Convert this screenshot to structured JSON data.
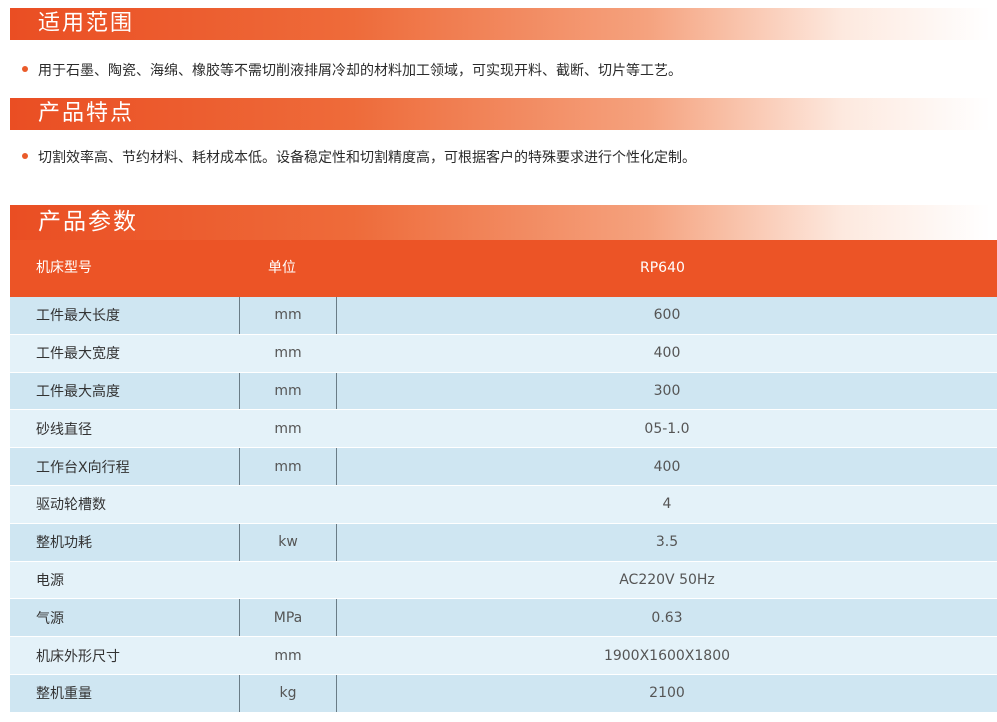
{
  "sections": {
    "scope": {
      "title": "适用范围",
      "text": "用于石墨、陶瓷、海绵、橡胶等不需切削液排屑冷却的材料加工领域，可实现开料、截断、切片等工艺。"
    },
    "features": {
      "title": "产品特点",
      "text": "切割效率高、节约材料、耗材成本低。设备稳定性和切割精度高，可根据客户的特殊要求进行个性化定制。"
    },
    "params": {
      "title": "产品参数"
    }
  },
  "table": {
    "headers": [
      "机床型号",
      "单位",
      "RP640"
    ],
    "rows": [
      {
        "name": "工件最大长度",
        "unit": "mm",
        "value": "600",
        "unit_bordered": true
      },
      {
        "name": "工件最大宽度",
        "unit": "mm",
        "value": "400",
        "unit_bordered": false
      },
      {
        "name": "工件最大高度",
        "unit": "mm",
        "value": "300",
        "unit_bordered": true
      },
      {
        "name": "砂线直径",
        "unit": "mm",
        "value": "05-1.0",
        "unit_bordered": false
      },
      {
        "name": "工作台X向行程",
        "unit": "mm",
        "value": "400",
        "unit_bordered": true
      },
      {
        "name": "驱动轮槽数",
        "unit": "",
        "value": "4",
        "unit_bordered": false
      },
      {
        "name": "整机功耗",
        "unit": "kw",
        "value": "3.5",
        "unit_bordered": true
      },
      {
        "name": "电源",
        "unit": "",
        "value": "AC220V 50Hz",
        "unit_bordered": false
      },
      {
        "name": "气源",
        "unit": "MPa",
        "value": "0.63",
        "unit_bordered": true
      },
      {
        "name": "机床外形尺寸",
        "unit": "mm",
        "value": "1900X1600X1800",
        "unit_bordered": false
      },
      {
        "name": "整机重量",
        "unit": "kg",
        "value": "2100",
        "unit_bordered": true
      }
    ]
  },
  "colors": {
    "accent": "#ec5426",
    "row_dark": "#cfe6f2",
    "row_light": "#e4f2f9"
  }
}
